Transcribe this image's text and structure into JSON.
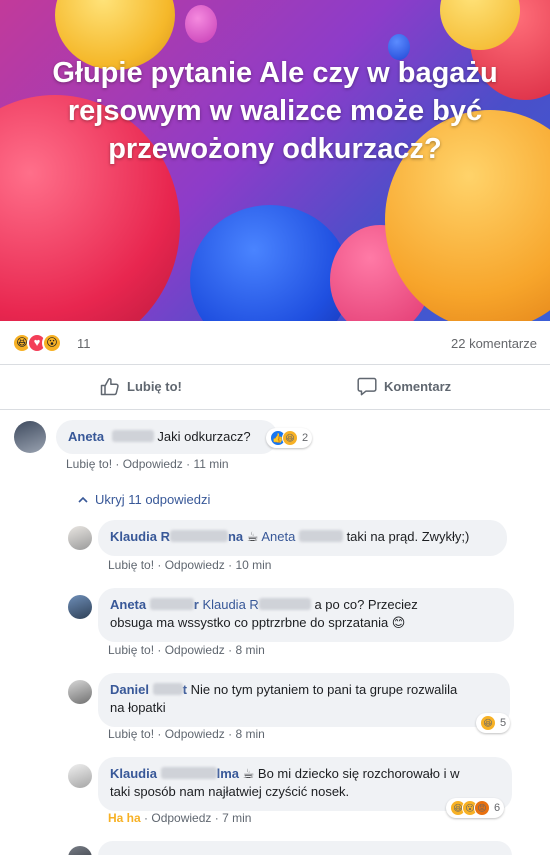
{
  "post": {
    "text": "Głupie pytanie Ale czy w bagażu rejsowym w walizce może być przewożony odkurzacz?",
    "colors": {
      "accent": "#385898",
      "like_blue": "#1877f2",
      "haha": "#f7b125",
      "love": "#f33e58"
    }
  },
  "summary": {
    "reaction_icons": [
      "haha-icon",
      "love-icon",
      "wow-icon"
    ],
    "reaction_count": "11",
    "comment_count": "22 komentarze"
  },
  "actions": {
    "like_label": "Lubię to!",
    "comment_label": "Komentarz"
  },
  "comments": [
    {
      "author": "Aneta",
      "text": "Jaki odkurzacz?",
      "reaction_icons": [
        "like-icon",
        "haha-icon"
      ],
      "reaction_count": "2",
      "like": "Lubię to!",
      "reply": "Odpowiedz",
      "time": "11 min"
    }
  ],
  "replies_toggle": "Ukryj 11 odpowiedzi",
  "replies": [
    {
      "author_start": "Klaudia R",
      "author_end": "na",
      "mention": "Aneta",
      "text": "taki na prąd. Zwykły;)",
      "like": "Lubię to!",
      "reply": "Odpowiedz",
      "time": "10 min"
    },
    {
      "author": "Aneta",
      "author_end": "r",
      "mention": "Klaudia R",
      "text_line1": "a po co? Przeciez",
      "text_line2": "obsuga ma wssystko co pptrzrbne do sprzatania 😊",
      "like": "Lubię to!",
      "reply": "Odpowiedz",
      "time": "8 min"
    },
    {
      "author": "Daniel",
      "author_end": "t",
      "text_line1": "Nie no tym pytaniem to pani ta grupe rozwalila",
      "text_line2": "na łopatki",
      "reaction_icons": [
        "haha-icon"
      ],
      "reaction_count": "5",
      "like": "Lubię to!",
      "reply": "Odpowiedz",
      "time": "8 min"
    },
    {
      "author": "Klaudia",
      "author_end": "lma",
      "text_line1": "Bo mi dziecko się rozchorowało i w",
      "text_line2": "taki sposób nam najłatwiej czyścić nosek.",
      "reaction_icons": [
        "haha-icon",
        "wow-icon",
        "angry-icon"
      ],
      "reaction_count": "6",
      "like": "Ha ha",
      "reply": "Odpowiedz",
      "time": "7 min"
    }
  ]
}
